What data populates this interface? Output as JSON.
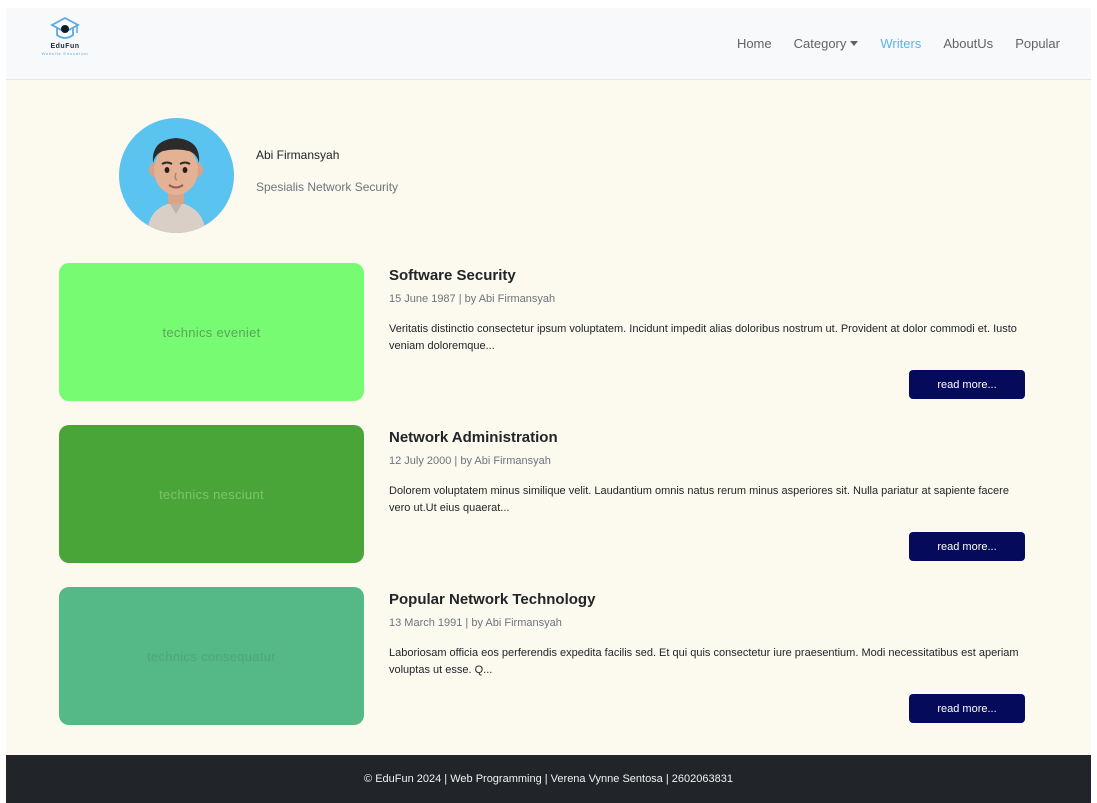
{
  "brand": {
    "name": "EduFun",
    "tagline": "Website Education"
  },
  "nav": {
    "items": [
      {
        "label": "Home",
        "active": false
      },
      {
        "label": "Category",
        "active": false,
        "dropdown": true
      },
      {
        "label": "Writers",
        "active": true
      },
      {
        "label": "AboutUs",
        "active": false
      },
      {
        "label": "Popular",
        "active": false
      }
    ]
  },
  "writer": {
    "name": "Abi Firmansyah",
    "role": "Spesialis Network Security"
  },
  "articles": [
    {
      "thumb_text": "technics eveniet",
      "thumb_color": "#77fb72",
      "thumb_text_color": "#5aa55a",
      "title": "Software Security",
      "meta": "15 June 1987 | by Abi Firmansyah",
      "description": "Veritatis distinctio consectetur ipsum voluptatem. Incidunt impedit alias doloribus nostrum ut. Provident at dolor commodi et. Iusto veniam doloremque...",
      "button": "read more..."
    },
    {
      "thumb_text": "technics nesciunt",
      "thumb_color": "#4aa538",
      "thumb_text_color": "#7cc26e",
      "title": "Network Administration",
      "meta": "12 July 2000 | by Abi Firmansyah",
      "description": "Dolorem voluptatem minus similique velit. Laudantium omnis natus rerum minus asperiores sit. Nulla pariatur at sapiente facere vero ut.Ut eius quaerat...",
      "button": "read more..."
    },
    {
      "thumb_text": "technics consequatur",
      "thumb_color": "#55b887",
      "thumb_text_color": "#4fa67c",
      "title": "Popular Network Technology",
      "meta": "13 March 1991 | by Abi Firmansyah",
      "description": "Laboriosam officia eos perferendis expedita facilis sed. Et qui quis consectetur iure praesentium. Modi necessitatibus est aperiam voluptas ut esse. Q...",
      "button": "read more..."
    }
  ],
  "footer": {
    "text": "© EduFun 2024 | Web Programming | Verena Vynne Sentosa | 2602063831"
  },
  "colors": {
    "accent": "#5cb3e6",
    "button": "#060a5a",
    "background": "#fcf9ef",
    "footer": "#212529"
  }
}
